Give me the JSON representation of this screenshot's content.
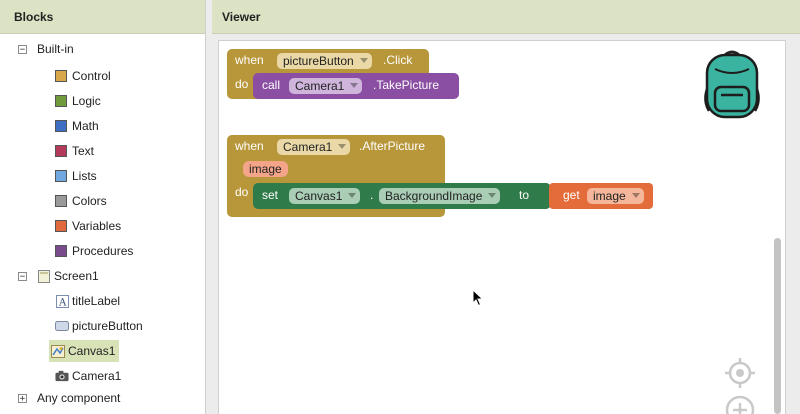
{
  "blocks_panel": {
    "title": "Blocks",
    "builtin": {
      "label": "Built-in",
      "toggle": "−",
      "items": [
        {
          "label": "Control",
          "color": "#d8a74a"
        },
        {
          "label": "Logic",
          "color": "#6f9b3d"
        },
        {
          "label": "Math",
          "color": "#3f6fc2"
        },
        {
          "label": "Text",
          "color": "#b43a5b"
        },
        {
          "label": "Lists",
          "color": "#6fa8df"
        },
        {
          "label": "Colors",
          "color": "#9a9a9a"
        },
        {
          "label": "Variables",
          "color": "#e06a3b"
        },
        {
          "label": "Procedures",
          "color": "#7a4b8c"
        }
      ]
    },
    "screen": {
      "label": "Screen1",
      "toggle": "−",
      "items": [
        {
          "label": "titleLabel",
          "icon": "label-icon"
        },
        {
          "label": "pictureButton",
          "icon": "button-icon"
        },
        {
          "label": "Canvas1",
          "icon": "canvas-icon",
          "selected": true
        },
        {
          "label": "Camera1",
          "icon": "camera-icon"
        }
      ]
    },
    "any_component": {
      "label": "Any component",
      "toggle": "+"
    }
  },
  "viewer": {
    "title": "Viewer",
    "block1": {
      "when": "when",
      "component": "pictureButton",
      "event": ".Click",
      "do": "do",
      "call": "call",
      "call_component": "Camera1",
      "method": ".TakePicture"
    },
    "block2": {
      "when": "when",
      "component": "Camera1",
      "event": ".AfterPicture",
      "param": "image",
      "do": "do",
      "set": "set",
      "set_component": "Canvas1",
      "dot": ".",
      "property": "BackgroundImage",
      "to": "to",
      "get": "get",
      "get_var": "image"
    }
  },
  "colors": {
    "event_block": "#b8963a",
    "method_block": "#8a4ea2",
    "setter_block": "#2f7b4a",
    "variable_block": "#e46c3a",
    "header_bg": "#dbe3c4"
  }
}
